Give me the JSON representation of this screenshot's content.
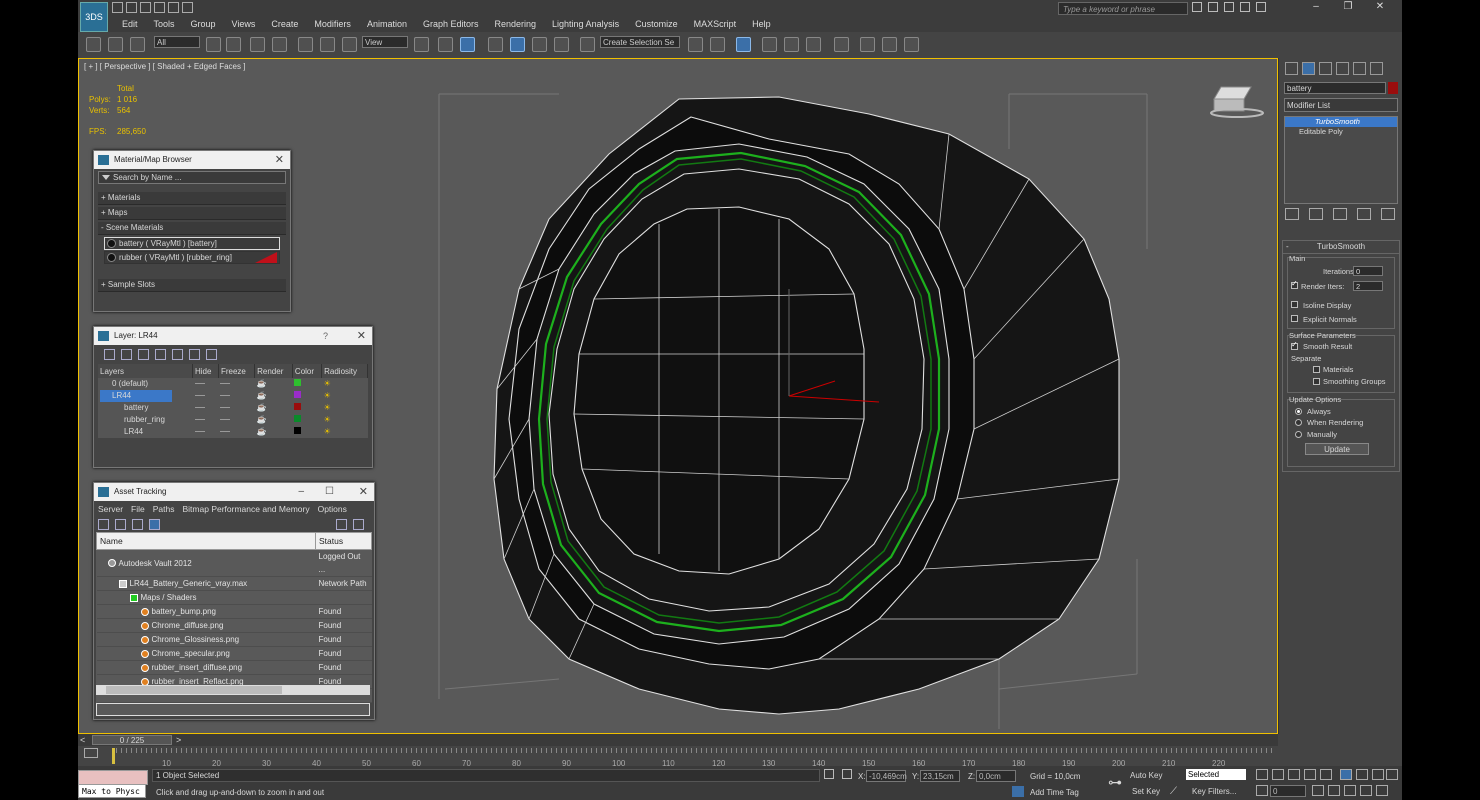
{
  "app": {
    "logo": "3DS"
  },
  "menu": [
    "Edit",
    "Tools",
    "Group",
    "Views",
    "Create",
    "Modifiers",
    "Animation",
    "Graph Editors",
    "Rendering",
    "Lighting Analysis",
    "Customize",
    "MAXScript",
    "Help"
  ],
  "search": {
    "placeholder": "Type a keyword or phrase"
  },
  "window_controls": [
    "–",
    "❐",
    "✕"
  ],
  "toolbar": {
    "filter": "All",
    "ref_coord": "View",
    "named_sel": "Create Selection Se"
  },
  "viewport": {
    "label": "[ + ] [ Perspective ] [ Shaded + Edged Faces ]",
    "stats": {
      "total_label": "Total",
      "polys_label": "Polys:",
      "polys": "1 016",
      "verts_label": "Verts:",
      "verts": "564"
    },
    "fps_label": "FPS:",
    "fps": "285,650"
  },
  "material_browser": {
    "title": "Material/Map Browser",
    "search": "Search by Name ...",
    "categories": [
      "+ Materials",
      "+ Maps",
      "- Scene Materials"
    ],
    "materials": [
      "battery  ( VRayMtl )  [battery]",
      "rubber  ( VRayMtl )  [rubber_ring]"
    ],
    "sample_slots": "+ Sample Slots"
  },
  "layers": {
    "title": "Layer: LR44",
    "columns": [
      "Layers",
      "Hide",
      "Freeze",
      "Render",
      "Color",
      "Radiosity"
    ],
    "rows": [
      {
        "name": "0 (default)",
        "color": "#2ec02e",
        "indent": 1
      },
      {
        "name": "LR44",
        "color": "#9a2cc8",
        "indent": 1,
        "selected": true
      },
      {
        "name": "battery",
        "color": "#9a0d0d",
        "indent": 2
      },
      {
        "name": "rubber_ring",
        "color": "#0a8a2a",
        "indent": 2
      },
      {
        "name": "LR44",
        "color": "#000000",
        "indent": 2
      }
    ]
  },
  "asset_tracking": {
    "title": "Asset Tracking",
    "menu": [
      "Server",
      "File",
      "Paths",
      "Bitmap Performance and Memory",
      "Options"
    ],
    "columns": [
      "Name",
      "Status"
    ],
    "rows": [
      {
        "name": "Autodesk Vault 2012",
        "status": "Logged Out ...",
        "indent": 1
      },
      {
        "name": "LR44_Battery_Generic_vray.max",
        "status": "Network Path",
        "indent": 2
      },
      {
        "name": "Maps / Shaders",
        "status": "",
        "indent": 3
      },
      {
        "name": "battery_bump.png",
        "status": "Found",
        "indent": 4
      },
      {
        "name": "Chrome_diffuse.png",
        "status": "Found",
        "indent": 4
      },
      {
        "name": "Chrome_Glossiness.png",
        "status": "Found",
        "indent": 4
      },
      {
        "name": "Chrome_specular.png",
        "status": "Found",
        "indent": 4
      },
      {
        "name": "rubber_insert_diffuse.png",
        "status": "Found",
        "indent": 4
      },
      {
        "name": "rubber_insert_Reflact.png",
        "status": "Found",
        "indent": 4
      }
    ]
  },
  "command_panel": {
    "object_name": "battery",
    "object_color": "#9a0d0d",
    "modifier_list": "Modifier List",
    "stack": [
      "TurboSmooth",
      "Editable Poly"
    ],
    "turbosmooth": {
      "title": "TurboSmooth",
      "main": "Main",
      "iterations_label": "Iterations:",
      "iterations": "0",
      "render_iters_label": "Render Iters:",
      "render_iters": "2",
      "isoline": "Isoline Display",
      "explicit": "Explicit Normals",
      "surface": "Surface Parameters",
      "smooth_result": "Smooth Result",
      "separate": "Separate",
      "materials": "Materials",
      "smoothing_groups": "Smoothing Groups",
      "update_options": "Update Options",
      "always": "Always",
      "when_rendering": "When Rendering",
      "manually": "Manually",
      "update": "Update"
    }
  },
  "timeline": {
    "frame": "0 / 225",
    "ticks": [
      "10",
      "20",
      "30",
      "40",
      "50",
      "60",
      "70",
      "80",
      "90",
      "100",
      "110",
      "120",
      "130",
      "140",
      "150",
      "160",
      "170",
      "180",
      "190",
      "200",
      "210",
      "220"
    ]
  },
  "status": {
    "maxscript": "Max to Physc",
    "selected": "1 Object Selected",
    "prompt": "Click and drag up-and-down to zoom in and out",
    "x_label": "X:",
    "x": "-10,469cm",
    "y_label": "Y:",
    "y": "23,15cm",
    "z_label": "Z:",
    "z": "0,0cm",
    "grid": "Grid = 10,0cm",
    "add_time_tag": "Add Time Tag",
    "auto_key": "Auto Key",
    "set_key": "Set Key",
    "key_selected": "Selected",
    "key_filters": "Key Filters...",
    "frame_value": "0"
  }
}
